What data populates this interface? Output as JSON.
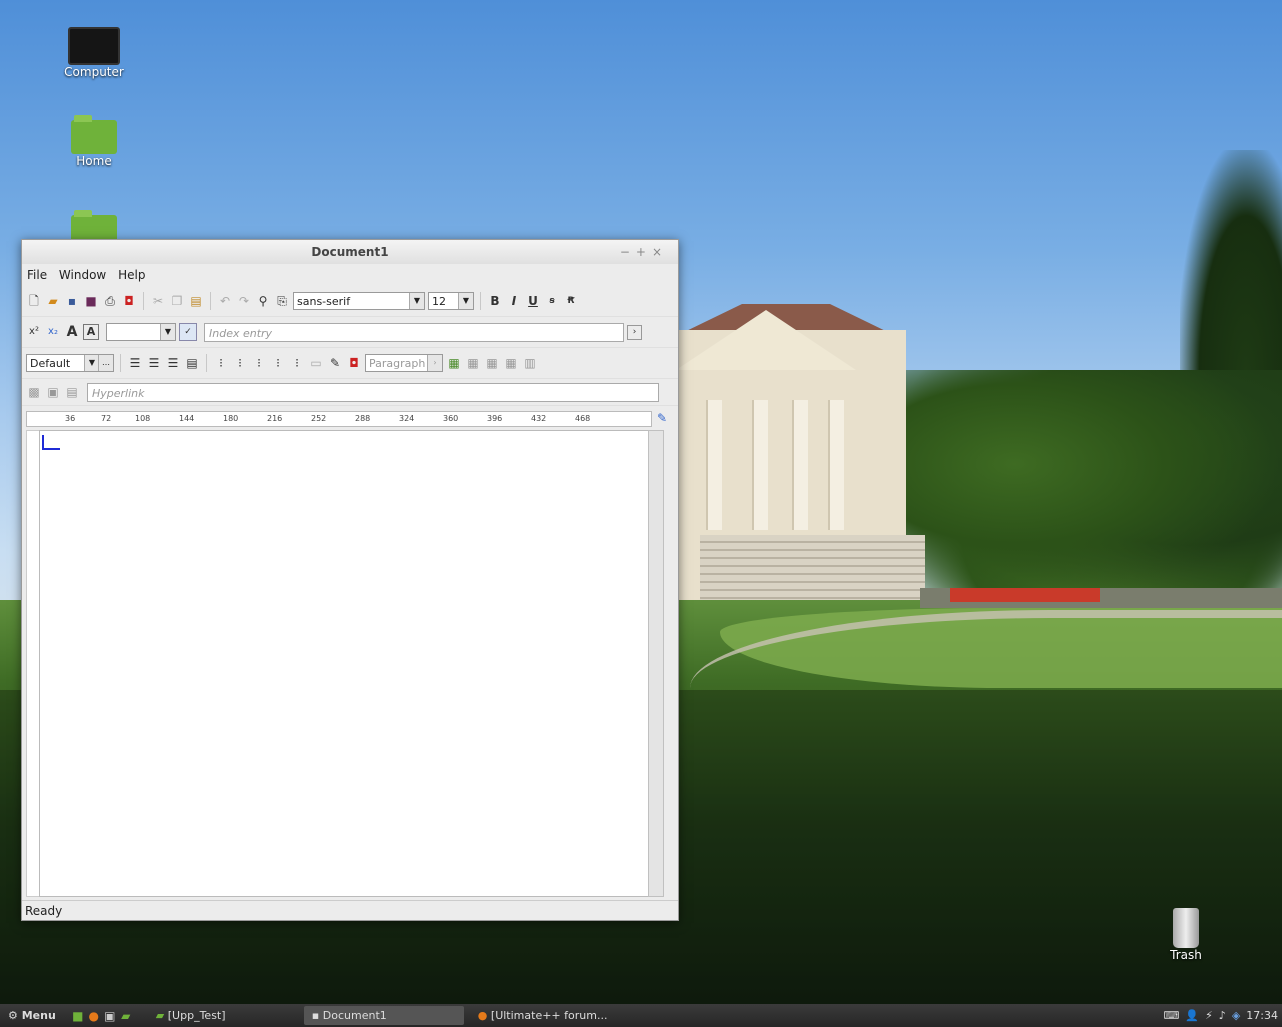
{
  "desktop": {
    "icons": [
      {
        "label": "Computer",
        "icon": "computer-icon"
      },
      {
        "label": "Home",
        "icon": "home-folder-icon"
      },
      {
        "label": "",
        "icon": "folder-icon"
      },
      {
        "label": "Trash",
        "icon": "trash-icon"
      }
    ]
  },
  "window": {
    "title": "Document1",
    "controls": [
      "−",
      "+",
      "×"
    ],
    "menu": [
      "File",
      "Window",
      "Help"
    ],
    "font_family": "sans-serif",
    "font_size": "12",
    "index_entry_placeholder": "Index entry",
    "style": "Default",
    "paragraph_label": "Paragraph",
    "hyperlink_placeholder": "Hyperlink",
    "ruler_marks": [
      "36",
      "72",
      "108",
      "144",
      "180",
      "216",
      "252",
      "288",
      "324",
      "360",
      "396",
      "432",
      "468"
    ],
    "status": "Ready"
  },
  "taskbar": {
    "menu_label": "Menu",
    "tasks": [
      "[Upp_Test]",
      "Document1",
      "[Ultimate++ forum..."
    ],
    "clock": "17:34"
  }
}
